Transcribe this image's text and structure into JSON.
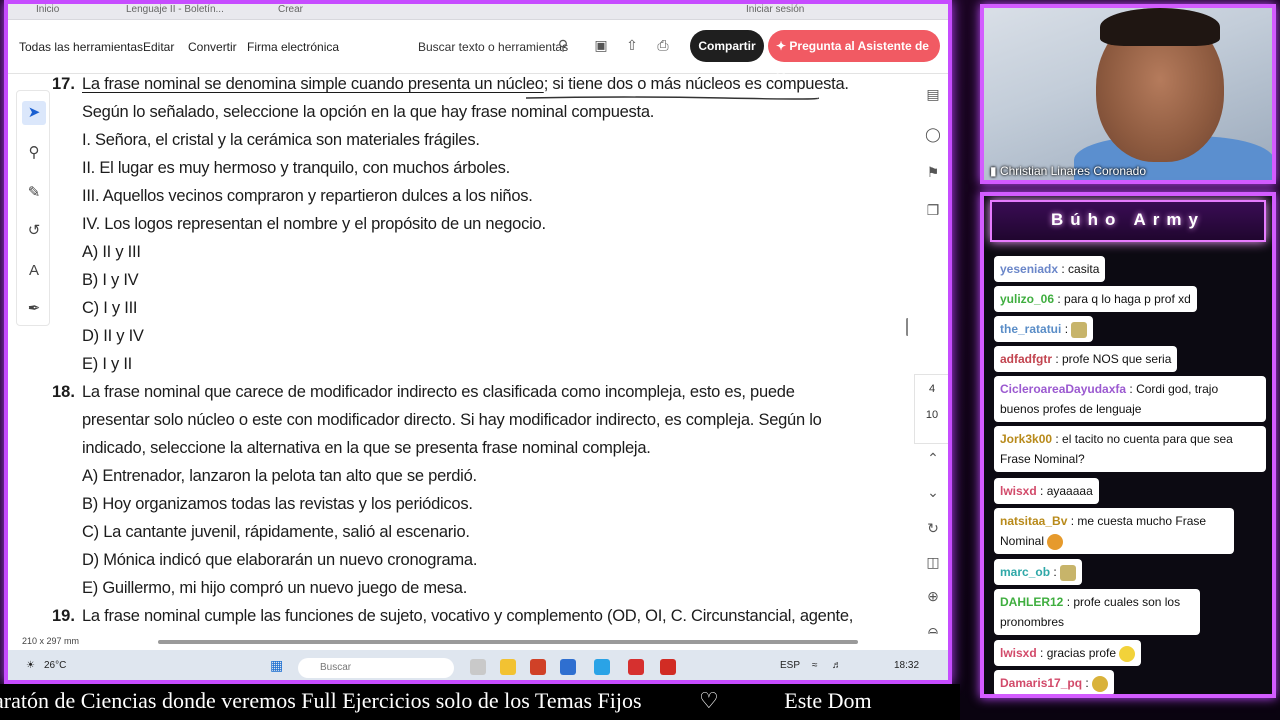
{
  "browser": {
    "tabs": [
      "Inicio",
      "Lenguaje II - Boletín...",
      "Crear"
    ],
    "signin": "Iniciar sesión"
  },
  "toolbar": {
    "menu": [
      "Todas las herramientas",
      "Editar",
      "Convertir",
      "Firma electrónica"
    ],
    "search_label": "Buscar texto o herramientas",
    "share_label": "Compartir",
    "ai_label": "Pregunta al Asistente de IA"
  },
  "document": {
    "q17": {
      "number": "17.",
      "line1a": "La frase nominal se denomina simple cuando presenta un núcleo",
      "line1b": "; si tiene dos o más núcleos es compuesta.",
      "line2": "Según lo señalado, seleccione la opción en la que hay frase nominal compuesta.",
      "statements": [
        "I. Señora, el cristal y la cerámica son materiales frágiles.",
        "II. El lugar es muy hermoso y tranquilo, con muchos árboles.",
        "III. Aquellos vecinos compraron y repartieron dulces a los niños.",
        "IV. Los logos representan el nombre y el propósito de un negocio."
      ],
      "options": [
        "A) II y III",
        "B) I y IV",
        "C) I y III",
        "D) II y IV",
        "E) I y II"
      ]
    },
    "q18": {
      "number": "18.",
      "lines": [
        "La frase nominal que carece de modificador indirecto es clasificada como incompleja, esto es, puede",
        "presentar solo núcleo o este con modificador directo. Si hay modificador indirecto, es compleja. Según lo",
        "indicado, seleccione la alternativa en la que se presenta frase nominal compleja."
      ],
      "options": [
        "A) Entrenador, lanzaron la pelota tan alto que se perdió.",
        "B) Hoy organizamos todas las revistas y los periódicos.",
        "C) La cantante juvenil, rápidamente, salió al escenario.",
        "D) Mónica indicó que elaborarán un nuevo cronograma.",
        "E) Guillermo, mi hijo compró un nuevo juego de mesa."
      ]
    },
    "q19": {
      "number": "19.",
      "line1": "La frase nominal cumple las funciones de sujeto, vocativo y complemento (OD, OI, C. Circunstancial, agente,"
    },
    "page_size": "210 x 297 mm",
    "page_current": "4",
    "page_total": "10"
  },
  "taskbar": {
    "weather": "26°C",
    "search_placeholder": "Buscar",
    "lang": "ESP",
    "time": "18:32"
  },
  "webcam": {
    "name": "Christian Linares Coronado"
  },
  "chat": {
    "title": "Búho Army",
    "messages": [
      {
        "user": "yeseniadx",
        "text": ": casita",
        "color": "#6a86c9"
      },
      {
        "user": "yulizo_06",
        "text": ": para q lo haga p prof xd",
        "color": "#3fae3f"
      },
      {
        "user": "the_ratatui",
        "text": ":",
        "color": "#5a8dc7"
      },
      {
        "user": "adfadfgtr",
        "text": ": profe NOS que seria",
        "color": "#c2444f"
      },
      {
        "user": "CicleroareaDayudaxfa",
        "text": ": Cordi god, trajo",
        "text2": "buenos profes de lenguaje",
        "color": "#9b59d0"
      },
      {
        "user": "Jork3k00",
        "text": ": el tacito no cuenta para que sea",
        "text2": "Frase Nominal?",
        "color": "#b88a1a"
      },
      {
        "user": "lwisxd",
        "text": ": ayaaaaa",
        "color": "#d24a6a"
      },
      {
        "user": "natsitaa_Bv",
        "text": ": me cuesta mucho Frase",
        "text2": "Nominal",
        "color": "#b88a1a"
      },
      {
        "user": "marc_ob",
        "text": ":",
        "color": "#2fa8a8"
      },
      {
        "user": "DAHLER12",
        "text": ": profe cuales son los",
        "text2": "pronombres",
        "color": "#3fae3f"
      },
      {
        "user": "lwisxd",
        "text": ": gracias profe",
        "color": "#d24a6a"
      },
      {
        "user": "Damaris17_pq",
        "text": ":",
        "color": "#d24a6a"
      }
    ]
  },
  "ticker": {
    "text": "aratón de Ciencias donde veremos Full Ejercicios solo de los Temas Fijos",
    "heart": "♡",
    "text2": "Este Dom"
  }
}
